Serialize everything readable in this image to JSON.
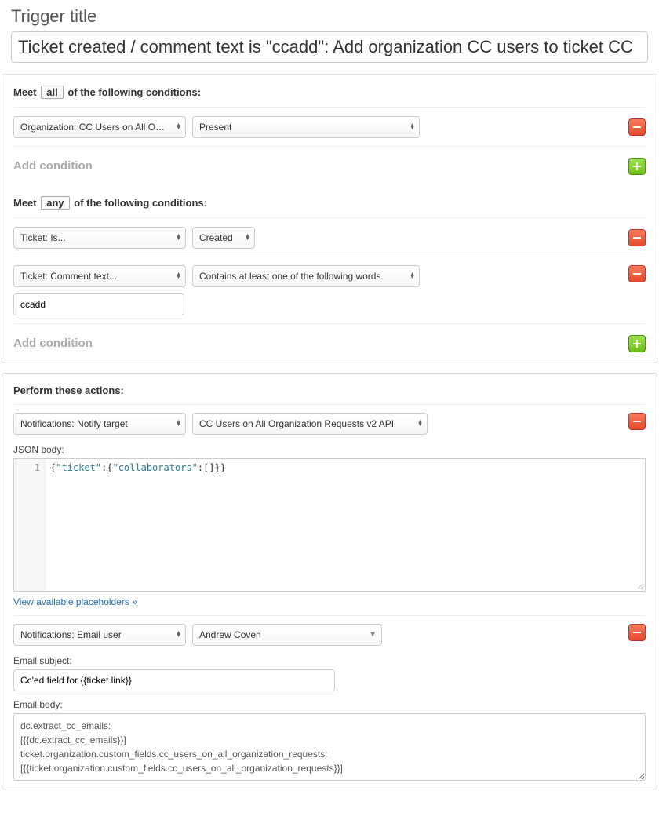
{
  "page_title": "Trigger title",
  "trigger_title_value": "Ticket created / comment text is \"ccadd\": Add organization CC users to ticket CC",
  "conditions_all": {
    "label_pre": "Meet",
    "label_boxed": "all",
    "label_post": "of the following conditions:",
    "rows": [
      {
        "field": "Organization: CC Users on All Organization Requests",
        "operator": "Present"
      }
    ],
    "add_label": "Add condition"
  },
  "conditions_any": {
    "label_pre": "Meet",
    "label_boxed": "any",
    "label_post": "of the following conditions:",
    "rows": [
      {
        "field": "Ticket: Is...",
        "operator": "Created"
      },
      {
        "field": "Ticket: Comment text...",
        "operator": "Contains at least one of the following words",
        "value": "ccadd"
      }
    ],
    "add_label": "Add condition"
  },
  "actions": {
    "heading": "Perform these actions:",
    "rows": [
      {
        "type": "notify_target",
        "field": "Notifications: Notify target",
        "target": "CC Users on All Organization Requests v2 API",
        "json_label": "JSON body:",
        "json_body_display": "{\"ticket\":{\"collaborators\":[]}}",
        "placeholders_link": "View available placeholders »"
      },
      {
        "type": "email_user",
        "field": "Notifications: Email user",
        "user": "Andrew Coven",
        "subject_label": "Email subject:",
        "subject_value": "Cc'ed field for {{ticket.link}}",
        "body_label": "Email body:",
        "body_value": "dc.extract_cc_emails:\n[{{dc.extract_cc_emails}}]\nticket.organization.custom_fields.cc_users_on_all_organization_requests:\n[{{ticket.organization.custom_fields.cc_users_on_all_organization_requests}}]"
      }
    ]
  }
}
